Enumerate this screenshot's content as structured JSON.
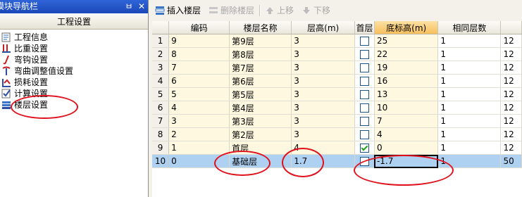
{
  "nav": {
    "title": "模块导航栏",
    "pin_glyph": "ㅂ",
    "close_glyph": "✕",
    "tab_label": "工程设置",
    "items": [
      {
        "label": "工程信息",
        "icon": "project-info-icon"
      },
      {
        "label": "比重设置",
        "icon": "density-icon"
      },
      {
        "label": "弯钩设置",
        "icon": "hook-icon"
      },
      {
        "label": "弯曲调整值设置",
        "icon": "bend-icon"
      },
      {
        "label": "损耗设置",
        "icon": "loss-icon"
      },
      {
        "label": "计算设置",
        "icon": "calc-icon"
      },
      {
        "label": "楼层设置",
        "icon": "floor-icon"
      }
    ]
  },
  "toolbar": {
    "insert_floor": "插入楼层",
    "delete_floor": "删除楼层",
    "move_up": "上移",
    "move_down": "下移"
  },
  "grid": {
    "columns": [
      "编码",
      "楼层名称",
      "层高(m)",
      "首层",
      "底标高(m)",
      "相同层数",
      ""
    ],
    "rows": [
      {
        "n": "1",
        "code": "9",
        "name": "第9层",
        "height": "3",
        "first": false,
        "elev": "25",
        "same": "1",
        "extra": "12"
      },
      {
        "n": "2",
        "code": "8",
        "name": "第8层",
        "height": "3",
        "first": false,
        "elev": "22",
        "same": "1",
        "extra": "12"
      },
      {
        "n": "3",
        "code": "7",
        "name": "第7层",
        "height": "3",
        "first": false,
        "elev": "19",
        "same": "1",
        "extra": "12"
      },
      {
        "n": "4",
        "code": "6",
        "name": "第6层",
        "height": "3",
        "first": false,
        "elev": "16",
        "same": "1",
        "extra": "12"
      },
      {
        "n": "5",
        "code": "5",
        "name": "第5层",
        "height": "3",
        "first": false,
        "elev": "13",
        "same": "1",
        "extra": "12"
      },
      {
        "n": "6",
        "code": "4",
        "name": "第4层",
        "height": "3",
        "first": false,
        "elev": "10",
        "same": "1",
        "extra": "12"
      },
      {
        "n": "7",
        "code": "3",
        "name": "第3层",
        "height": "3",
        "first": false,
        "elev": "7",
        "same": "1",
        "extra": "12"
      },
      {
        "n": "8",
        "code": "2",
        "name": "第2层",
        "height": "3",
        "first": false,
        "elev": "4",
        "same": "1",
        "extra": "12"
      },
      {
        "n": "9",
        "code": "1",
        "name": "首层",
        "height": "4",
        "first": true,
        "elev": "0",
        "same": "1",
        "extra": "12"
      },
      {
        "n": "10",
        "code": "0",
        "name": "基础层",
        "height": "1.7",
        "first": false,
        "elev": "-1.7",
        "same": "1",
        "extra": "50"
      }
    ]
  },
  "colors": {
    "annotation": "#e0101c",
    "selection": "#aed0f1",
    "highlight_header": "#f7bf5c"
  }
}
